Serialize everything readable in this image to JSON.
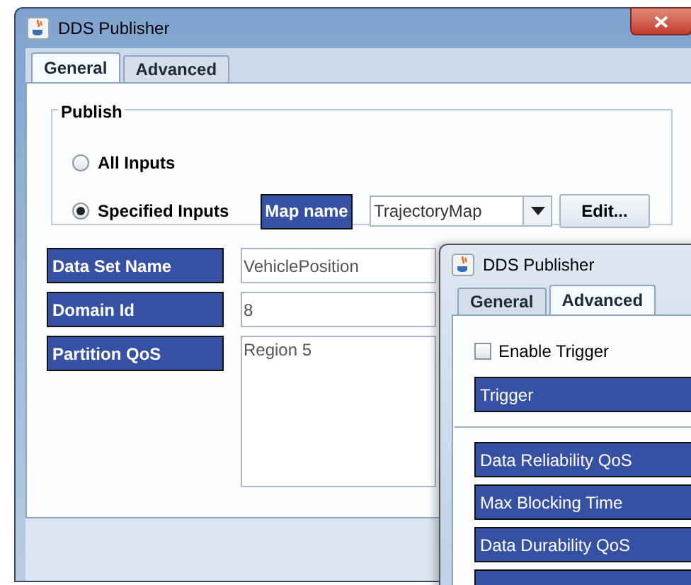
{
  "main_window": {
    "title": "DDS Publisher",
    "tabs": [
      {
        "label": "General",
        "selected": true
      },
      {
        "label": "Advanced",
        "selected": false
      }
    ],
    "publish_group": {
      "title": "Publish",
      "options": [
        {
          "label": "All Inputs",
          "selected": false
        },
        {
          "label": "Specified Inputs",
          "selected": true
        }
      ],
      "map_name_label": "Map name",
      "map_name_value": "TrajectoryMap",
      "edit_button": "Edit..."
    },
    "fields": [
      {
        "kind": "line",
        "label": "Data Set Name",
        "value": "VehiclePosition"
      },
      {
        "kind": "line",
        "label": "Domain Id",
        "value": "8"
      },
      {
        "kind": "area",
        "label": "Partition QoS",
        "value": "Region 5"
      }
    ]
  },
  "second_window": {
    "title": "DDS Publisher",
    "tabs": [
      {
        "label": "General",
        "selected": false
      },
      {
        "label": "Advanced",
        "selected": true
      }
    ],
    "enable_trigger": {
      "label": "Enable Trigger",
      "checked": false
    },
    "trigger_label": "Trigger",
    "qos_labels": [
      "Data Reliability QoS",
      "Max Blocking Time",
      "Data Durability QoS"
    ]
  }
}
